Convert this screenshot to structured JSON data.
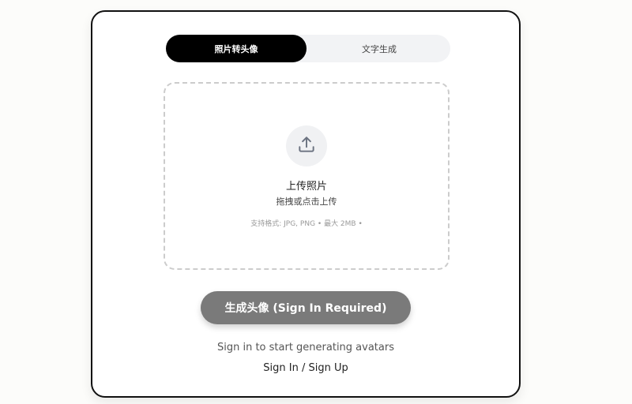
{
  "tabs": [
    {
      "label": "照片转头像",
      "active": true
    },
    {
      "label": "文字生成",
      "active": false
    }
  ],
  "upload": {
    "icon": "upload-icon",
    "title": "上传照片",
    "subtitle": "拖拽或点击上传",
    "hint": "支持格式: JPG, PNG • 最大 2MB •"
  },
  "generate_button": {
    "label": "生成头像 (Sign In Required)",
    "disabled": true
  },
  "signin": {
    "message": "Sign in to start generating avatars",
    "link": "Sign In / Sign Up"
  },
  "colors": {
    "accent": "#000000",
    "button_disabled": "#7a7a7a",
    "tab_bg": "#f2f3f5"
  }
}
